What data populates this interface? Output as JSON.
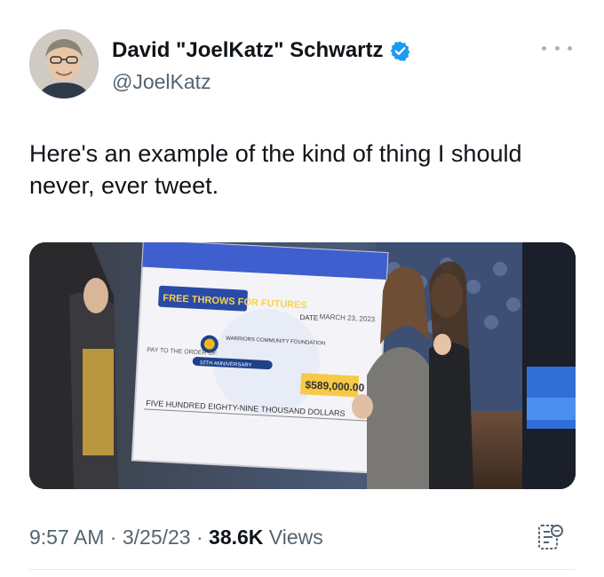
{
  "author": {
    "display_name": "David \"JoelKatz\" Schwartz",
    "handle": "@JoelKatz",
    "verified": true,
    "verified_color": "#1d9bf0"
  },
  "tweet": {
    "text": "Here's an example of the kind of thing I should never, ever tweet."
  },
  "media": {
    "check": {
      "brand": "FREE THROWS FOR FUTURES",
      "date_label": "DATE",
      "date": "MARCH 23, 2023",
      "foundation": "WARRIORS COMMUNITY FOUNDATION",
      "anniversary": "10TH ANNIVERSARY",
      "pay_to_label": "PAY TO THE ORDER OF",
      "amount": "$589,000.00",
      "amount_words": "FIVE HUNDRED EIGHTY-NINE THOUSAND DOLLARS"
    }
  },
  "meta": {
    "time": "9:57 AM",
    "sep1": " · ",
    "date": "3/25/23",
    "sep2": " · ",
    "views_count": "38.6K",
    "views_label": " Views"
  },
  "icons": {
    "more": "more-options-icon",
    "verified": "verified-badge-icon",
    "analytics": "grok-icon"
  }
}
